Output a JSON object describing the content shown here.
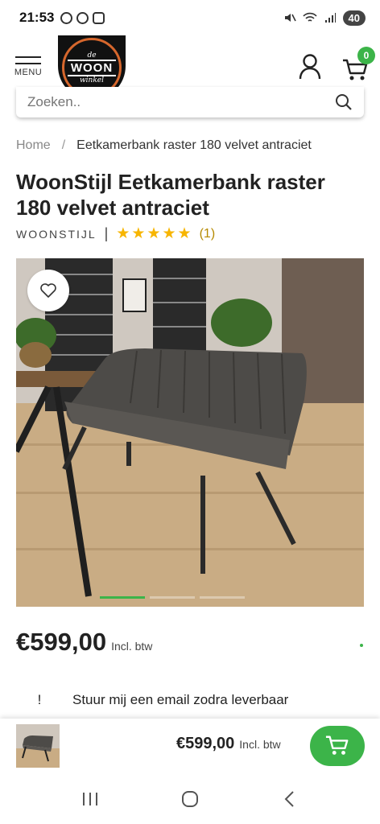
{
  "status_bar": {
    "time": "21:53",
    "battery": "40"
  },
  "header": {
    "menu_label": "MENU",
    "logo": {
      "top": "de",
      "main": "WOON",
      "bottom": "winkel"
    },
    "cart_count": "0"
  },
  "search": {
    "placeholder": "Zoeken.."
  },
  "breadcrumb": {
    "home": "Home",
    "separator": "/",
    "current": "Eetkamerbank raster 180 velvet antraciet"
  },
  "product": {
    "title": "WoonStijl Eetkamerbank raster 180 velvet antraciet",
    "brand": "WOONSTIJL",
    "brand_separator": "|",
    "rating": 5,
    "stars": [
      "★",
      "★",
      "★",
      "★",
      "★"
    ],
    "review_count": "(1)",
    "price": "€599,00",
    "vat_label": "Incl. btw",
    "image_slides": 4,
    "active_slide": 1
  },
  "notify": {
    "icon": "!",
    "label": "Stuur mij een email zodra leverbaar"
  },
  "sticky": {
    "price": "€599,00",
    "vat_label": "Incl. btw"
  },
  "colors": {
    "accent": "#3cb449",
    "star": "#f7b500",
    "logo_ring": "#d6672d"
  },
  "icons": [
    "whatsapp-icon",
    "edge-icon",
    "instagram-icon",
    "mute-icon",
    "wifi-icon",
    "signal-icon",
    "account-icon",
    "cart-icon",
    "search-icon",
    "heart-icon",
    "add-to-cart-icon",
    "recents-icon",
    "home-icon",
    "back-icon"
  ]
}
